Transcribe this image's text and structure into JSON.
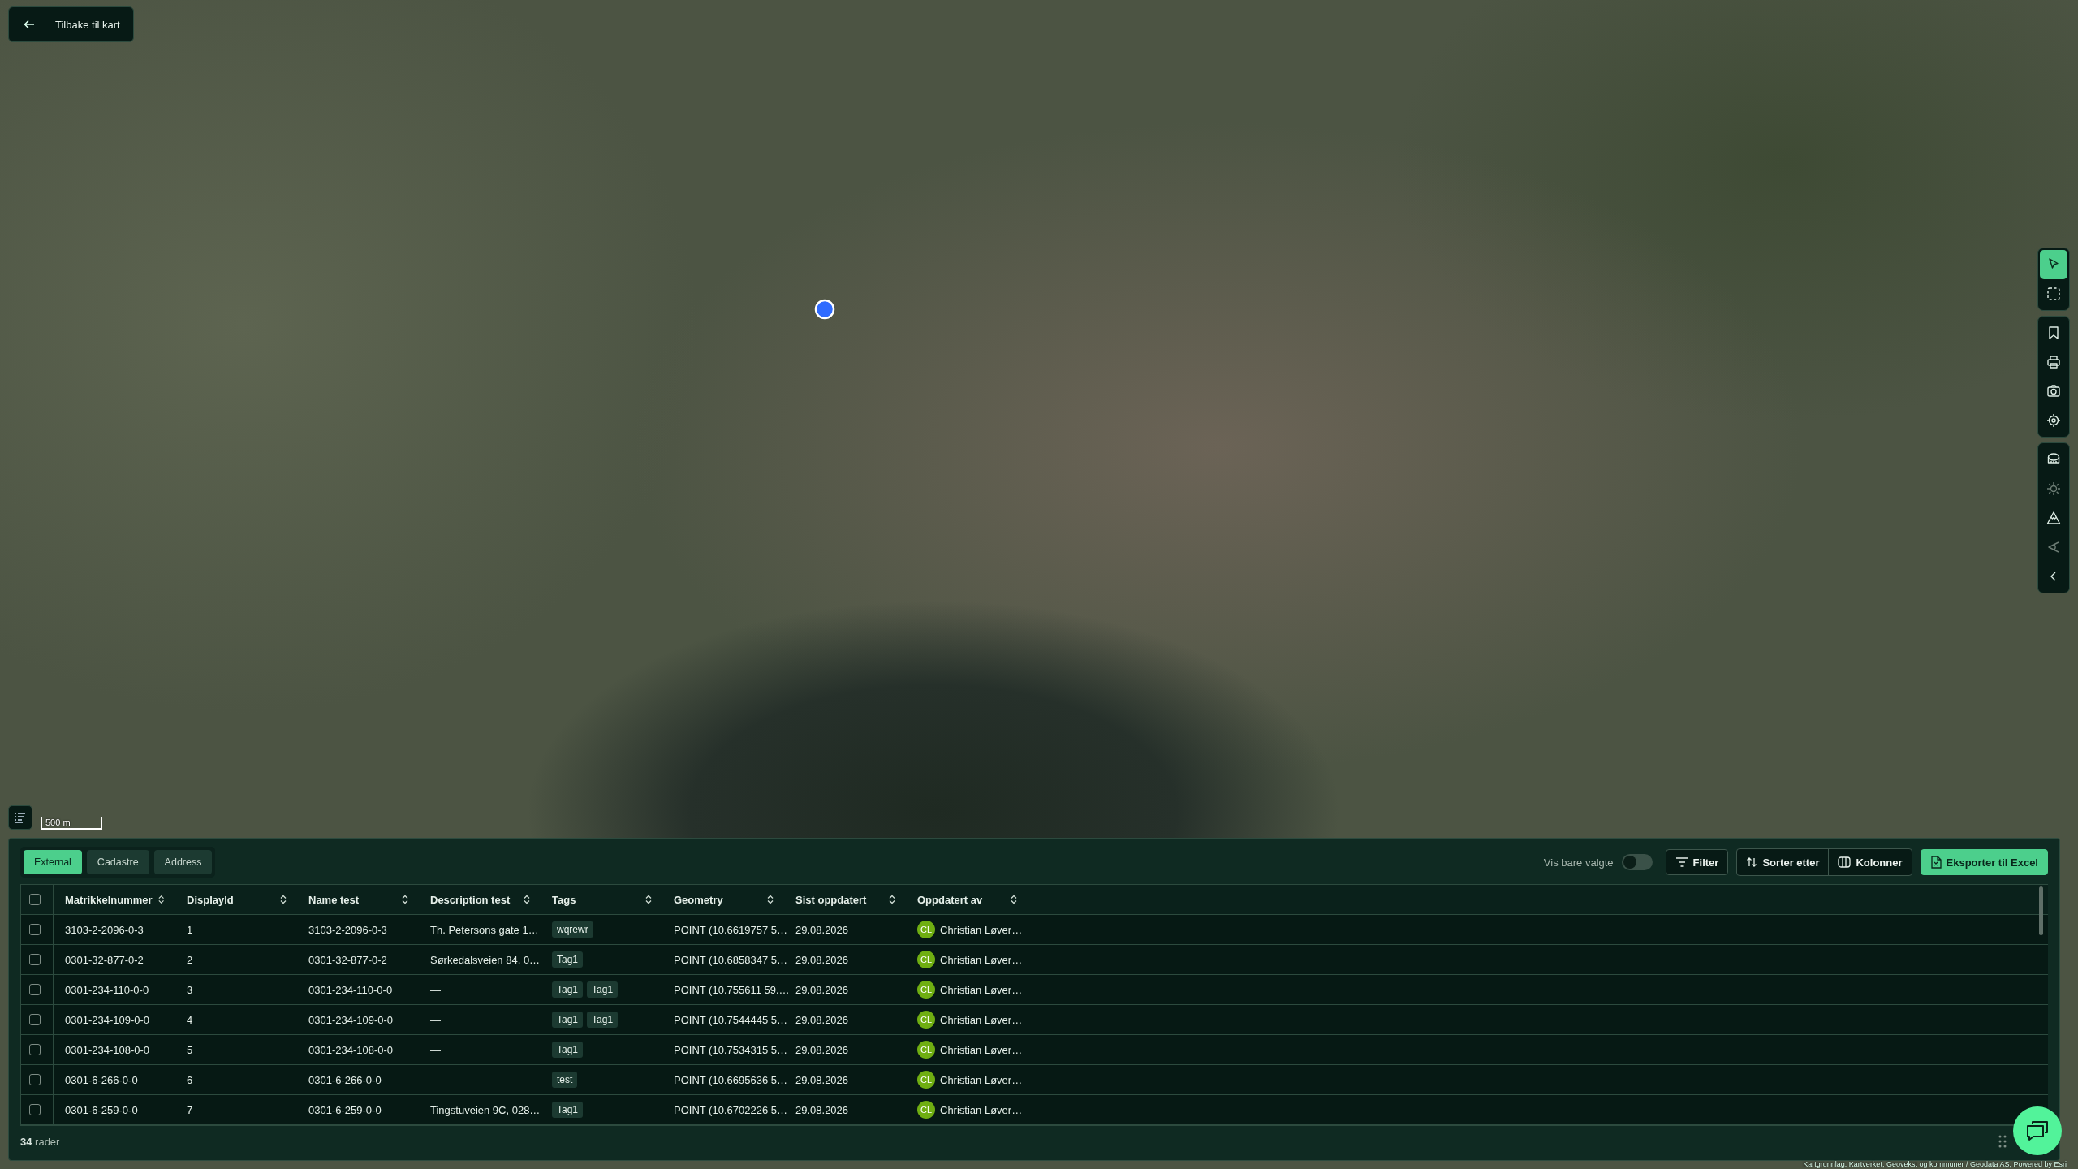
{
  "back_button": {
    "label": "Tilbake til kart"
  },
  "map_toolbar": {
    "groups": [
      [
        {
          "selected": true,
          "disabled": false
        },
        {
          "selected": false,
          "disabled": false
        }
      ],
      [
        {
          "selected": false,
          "disabled": false
        },
        {
          "selected": false,
          "disabled": false
        },
        {
          "selected": false,
          "disabled": false
        },
        {
          "selected": false,
          "disabled": false
        }
      ],
      [
        {
          "selected": false,
          "disabled": false
        },
        {
          "selected": false,
          "disabled": true
        },
        {
          "selected": false,
          "disabled": false
        },
        {
          "selected": false,
          "disabled": true
        },
        {
          "selected": false,
          "disabled": false
        }
      ]
    ]
  },
  "scale_bar": "500 m",
  "attribution": "Kartgrunnlag: Kartverket, Geovekst og kommuner / Geodata AS, Powered by Esri",
  "tabs": [
    {
      "label": "External",
      "selected": true
    },
    {
      "label": "Cadastre",
      "selected": false
    },
    {
      "label": "Address",
      "selected": false
    }
  ],
  "show_selected_only": {
    "label": "Vis bare valgte",
    "on": false
  },
  "buttons": {
    "filter": "Filter",
    "sort": "Sorter etter",
    "columns": "Kolonner",
    "export": "Eksporter til Excel"
  },
  "table": {
    "all_checked": false,
    "columns": [
      "Matrikkelnummer",
      "DisplayId",
      "Name test",
      "Description test",
      "Tags",
      "Geometry",
      "Sist oppdatert",
      "Oppdatert av"
    ],
    "rows": [
      {
        "checked": false,
        "matrikkel": "3103-2-2096-0-3",
        "display_id": "1",
        "name": "3103-2-2096-0-3",
        "description": "Th. Petersons gate 1…",
        "tags": [
          "wqrewr"
        ],
        "geometry": "POINT (10.6619757 5…",
        "updated": "29.08.2026",
        "initials": "CL",
        "updated_by": "Christian Løver…"
      },
      {
        "checked": false,
        "matrikkel": "0301-32-877-0-2",
        "display_id": "2",
        "name": "0301-32-877-0-2",
        "description": "Sørkedalsveien 84, 0…",
        "tags": [
          "Tag1"
        ],
        "geometry": "POINT (10.6858347 5…",
        "updated": "29.08.2026",
        "initials": "CL",
        "updated_by": "Christian Løver…"
      },
      {
        "checked": false,
        "matrikkel": "0301-234-110-0-0",
        "display_id": "3",
        "name": "0301-234-110-0-0",
        "description": "—",
        "tags": [
          "Tag1",
          "Tag1"
        ],
        "geometry": "POINT (10.755611 59.…",
        "updated": "29.08.2026",
        "initials": "CL",
        "updated_by": "Christian Løver…"
      },
      {
        "checked": false,
        "matrikkel": "0301-234-109-0-0",
        "display_id": "4",
        "name": "0301-234-109-0-0",
        "description": "—",
        "tags": [
          "Tag1",
          "Tag1"
        ],
        "geometry": "POINT (10.7544445 5…",
        "updated": "29.08.2026",
        "initials": "CL",
        "updated_by": "Christian Løver…"
      },
      {
        "checked": false,
        "matrikkel": "0301-234-108-0-0",
        "display_id": "5",
        "name": "0301-234-108-0-0",
        "description": "—",
        "tags": [
          "Tag1"
        ],
        "geometry": "POINT (10.7534315 5…",
        "updated": "29.08.2026",
        "initials": "CL",
        "updated_by": "Christian Løver…"
      },
      {
        "checked": false,
        "matrikkel": "0301-6-266-0-0",
        "display_id": "6",
        "name": "0301-6-266-0-0",
        "description": "—",
        "tags": [
          "test"
        ],
        "geometry": "POINT (10.6695636 5…",
        "updated": "29.08.2026",
        "initials": "CL",
        "updated_by": "Christian Løver…"
      },
      {
        "checked": false,
        "matrikkel": "0301-6-259-0-0",
        "display_id": "7",
        "name": "0301-6-259-0-0",
        "description": "Tingstuveien 9C, 028…",
        "tags": [
          "Tag1"
        ],
        "geometry": "POINT (10.6702226 5…",
        "updated": "29.08.2026",
        "initials": "CL",
        "updated_by": "Christian Løver…"
      }
    ]
  },
  "row_count": {
    "number": "34",
    "label": "rader"
  }
}
